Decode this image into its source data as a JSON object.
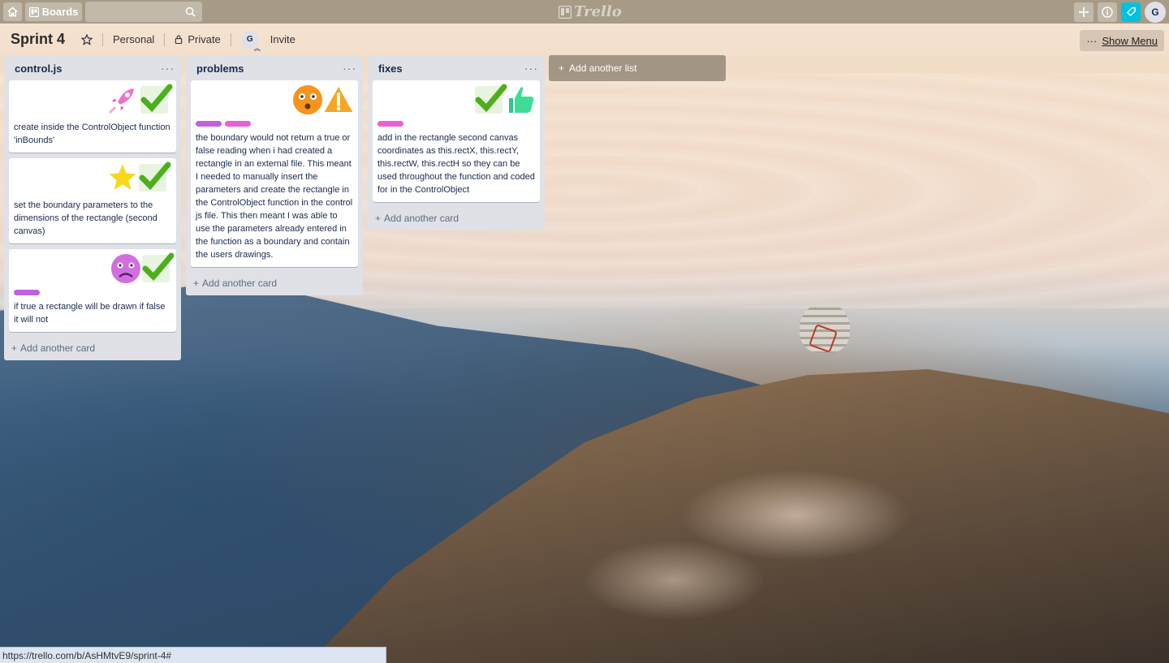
{
  "topbar": {
    "boards_label": "Boards",
    "search_value": "",
    "logo_text": "Trello",
    "avatar_initial": "G"
  },
  "board": {
    "title": "Sprint 4",
    "team": "Personal",
    "visibility": "Private",
    "member_initial": "G",
    "invite_label": "Invite",
    "menu_label": "Show Menu"
  },
  "lists": [
    {
      "title": "control.js",
      "add_card": "Add another card",
      "cards": [
        {
          "stickers": [
            "rocket",
            "check"
          ],
          "labels": [],
          "text": "create inside the ControlObject function 'inBounds'"
        },
        {
          "stickers": [
            "star",
            "check"
          ],
          "labels": [],
          "text": "set the boundary parameters to the dimensions of the rectangle (second canvas)"
        },
        {
          "stickers": [
            "sad-face",
            "check"
          ],
          "labels": [
            "purple"
          ],
          "text": "if true a rectangle will be drawn if false it will not"
        }
      ]
    },
    {
      "title": "problems",
      "add_card": "Add another card",
      "cards": [
        {
          "stickers": [
            "surprised-face",
            "warning"
          ],
          "labels": [
            "purple",
            "pink"
          ],
          "text": "the boundary would not return a true or false reading when i had created a rectangle in an external file. This meant I needed to manually insert the parameters and create the rectangle in the ControlObject function in the control js file. This then meant I was able to use the parameters already entered in the function as a boundary and contain the users drawings."
        }
      ]
    },
    {
      "title": "fixes",
      "add_card": "Add another card",
      "cards": [
        {
          "stickers": [
            "check",
            "thumbs-up"
          ],
          "labels": [
            "pink"
          ],
          "text": "add in the rectangle second canvas coordinates as this.rectX, this.rectY, this.rectW, this.rectH so they can be used throughout the function and coded for in the ControlObject"
        }
      ]
    }
  ],
  "add_list_label": "Add another list",
  "status_url": "https://trello.com/b/AsHMtvE9/sprint-4#",
  "colors": {
    "label_pink": "#e95fd4",
    "label_purple": "#c05fe0",
    "list_bg": "#dfe1e6",
    "notification_accent": "#00c2e0"
  }
}
